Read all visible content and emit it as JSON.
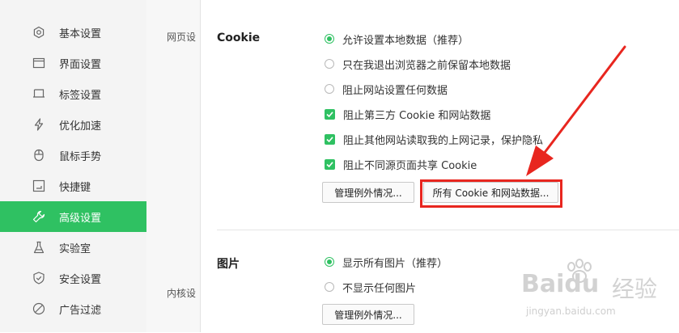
{
  "sidebar": {
    "items": [
      {
        "label": "基本设置",
        "icon": "settings-gear-icon"
      },
      {
        "label": "界面设置",
        "icon": "window-layout-icon"
      },
      {
        "label": "标签设置",
        "icon": "tab-icon"
      },
      {
        "label": "优化加速",
        "icon": "lightning-bolt-icon"
      },
      {
        "label": "鼠标手势",
        "icon": "mouse-icon"
      },
      {
        "label": "快捷键",
        "icon": "keyboard-shortcut-icon"
      },
      {
        "label": "高级设置",
        "icon": "wrench-icon",
        "active": true
      },
      {
        "label": "实验室",
        "icon": "flask-icon"
      },
      {
        "label": "安全设置",
        "icon": "shield-icon"
      },
      {
        "label": "广告过滤",
        "icon": "block-circle-icon"
      }
    ]
  },
  "middle": {
    "labels": [
      "网页设",
      "内核设"
    ]
  },
  "cookie": {
    "title": "Cookie",
    "options": [
      {
        "type": "radio",
        "checked": true,
        "label": "允许设置本地数据（推荐）"
      },
      {
        "type": "radio",
        "checked": false,
        "label": "只在我退出浏览器之前保留本地数据"
      },
      {
        "type": "radio",
        "checked": false,
        "label": "阻止网站设置任何数据"
      },
      {
        "type": "checkbox",
        "checked": true,
        "label": "阻止第三方 Cookie 和网站数据"
      },
      {
        "type": "checkbox",
        "checked": true,
        "label": "阻止其他网站读取我的上网记录，保护隐私"
      },
      {
        "type": "checkbox",
        "checked": true,
        "label": "阻止不同源页面共享 Cookie"
      }
    ],
    "manage_exceptions": "管理例外情况...",
    "all_cookies": "所有 Cookie 和网站数据..."
  },
  "images": {
    "title": "图片",
    "options": [
      {
        "type": "radio",
        "checked": true,
        "label": "显示所有图片（推荐）"
      },
      {
        "type": "radio",
        "checked": false,
        "label": "不显示任何图片"
      }
    ],
    "manage_exceptions": "管理例外情况..."
  },
  "watermark": {
    "brand": "Baidu",
    "brand_cn": "经验",
    "url": "jingyan.baidu.com"
  },
  "colors": {
    "accent": "#2fc162",
    "highlight": "#e8261f",
    "sidebar_bg": "#f4f4f4"
  }
}
